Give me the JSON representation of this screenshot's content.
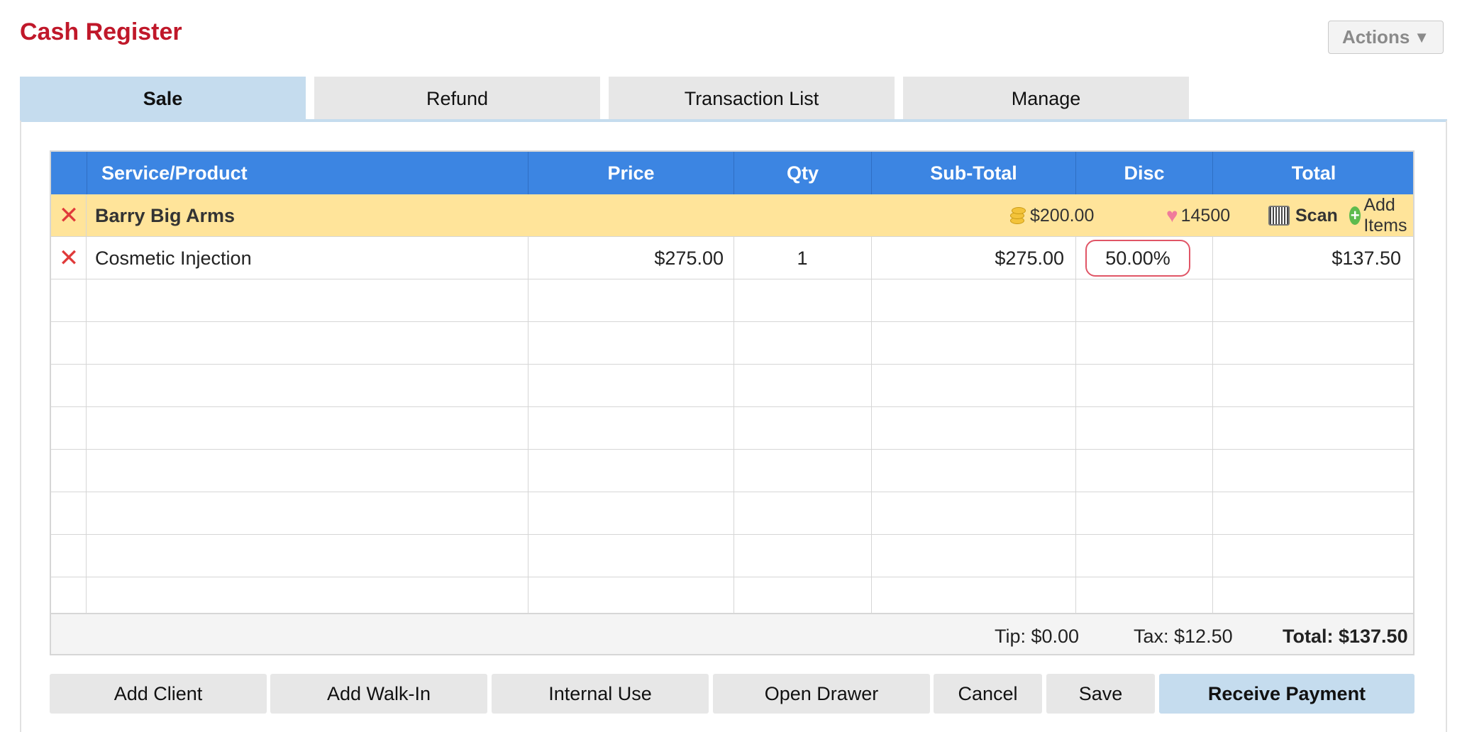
{
  "title": "Cash Register",
  "actions": {
    "label": "Actions",
    "arrow": "▼"
  },
  "tabs": [
    {
      "label": "Sale",
      "active": true
    },
    {
      "label": "Refund",
      "active": false
    },
    {
      "label": "Transaction List",
      "active": false
    },
    {
      "label": "Manage",
      "active": false
    }
  ],
  "table": {
    "headers": [
      "Service/Product",
      "Price",
      "Qty",
      "Sub-Total",
      "Disc",
      "Total"
    ],
    "client": {
      "name": "Barry Big Arms",
      "account_balance": "$200.00",
      "loyalty_points": "14500",
      "scan_label": "Scan",
      "add_items_label": "Add Items"
    },
    "items": [
      {
        "name": "Cosmetic Injection",
        "price": "$275.00",
        "qty": "1",
        "subtotal": "$275.00",
        "disc": "50.00%",
        "total": "$137.50"
      }
    ]
  },
  "summary": {
    "tip": "Tip: $0.00",
    "tax": "Tax: $12.50",
    "total": "Total: $137.50"
  },
  "buttons": {
    "add_client": "Add Client",
    "add_walkin": "Add Walk-In",
    "internal_use": "Internal Use",
    "open_drawer": "Open Drawer",
    "cancel": "Cancel",
    "save": "Save",
    "receive_payment": "Receive Payment"
  },
  "colors": {
    "title": "#c0182a",
    "header": "#3c85e2",
    "client_row": "#ffe49a",
    "active_tab": "#c5dcee",
    "disc_outline": "#e05566"
  }
}
